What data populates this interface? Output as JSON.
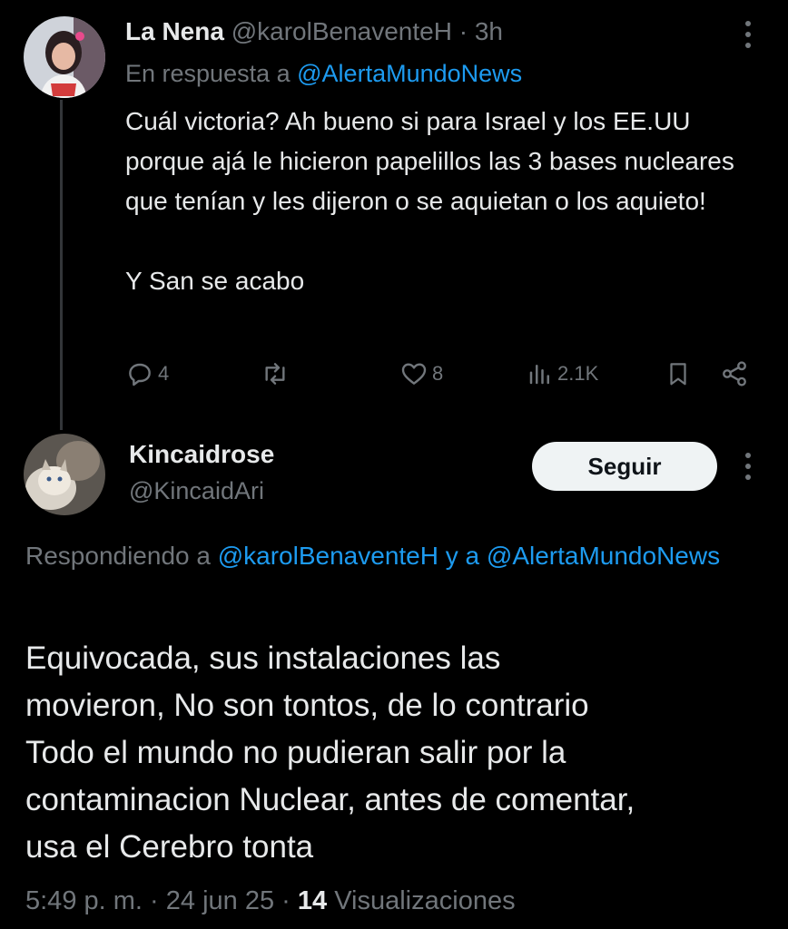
{
  "parent_tweet": {
    "author_name": "La Nena",
    "author_handle": "@karolBenaventeH",
    "separator": "·",
    "time": "3h",
    "in_reply_prefix": "En respuesta a",
    "in_reply_handle": "@AlertaMundoNews",
    "text": "Cuál victoria? Ah bueno si para Israel y los EE.UU porque ajá le hicieron papelillos las 3 bases nucleares que tenían y les dijeron o se aquietan o los aquieto!\n\nY San se acabo",
    "replies": "4",
    "likes": "8",
    "views": "2.1K",
    "icons": {
      "reply": "reply-icon",
      "retweet": "retweet-icon",
      "like": "heart-icon",
      "views": "views-icon",
      "bookmark": "bookmark-icon",
      "share": "share-icon",
      "more": "more-icon"
    }
  },
  "reply_tweet": {
    "author_name": "Kincaidrose",
    "author_handle": "@KincaidAri",
    "follow_label": "Seguir",
    "replying_prefix": "Respondiendo a",
    "replying_handle_1": "@karolBenaventeH",
    "replying_join": "y a",
    "replying_handle_2": "@AlertaMundoNews",
    "text": "Equivocada, sus instalaciones las\nmovieron, No son tontos, de lo contrario\nTodo el mundo no pudieran salir por la\ncontaminacion Nuclear, antes de comentar,\nusa el Cerebro tonta",
    "time": "5:49 p. m.",
    "dot": "·",
    "date": "24 jun 25",
    "views_count": "14",
    "views_label": "Visualizaciones"
  },
  "colors": {
    "background": "#000000",
    "text": "#e7e9ea",
    "muted": "#71767b",
    "link": "#1d9bf0",
    "follow_bg": "#eff3f4"
  }
}
